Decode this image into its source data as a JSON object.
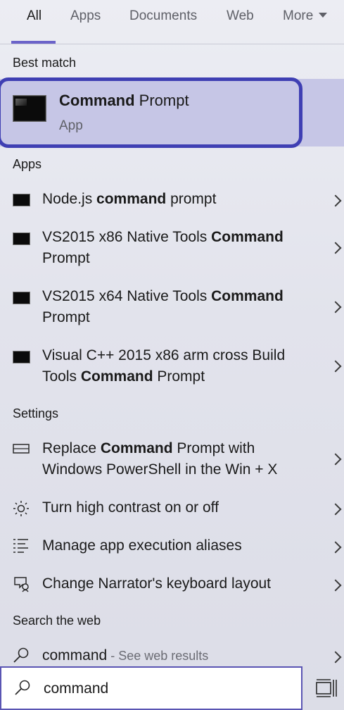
{
  "tabs": [
    {
      "label": "All"
    },
    {
      "label": "Apps"
    },
    {
      "label": "Documents"
    },
    {
      "label": "Web"
    },
    {
      "label": "More"
    }
  ],
  "sections": {
    "best_match": "Best match",
    "apps": "Apps",
    "settings": "Settings",
    "web": "Search the web"
  },
  "best": {
    "title_bold": "Command",
    "title_rest": " Prompt",
    "subtitle": "App"
  },
  "apps": [
    {
      "pre": "Node.js ",
      "bold": "command",
      "post": " prompt",
      "line2": ""
    },
    {
      "pre": "VS2015 x86 Native Tools ",
      "bold": "Command",
      "post": "",
      "line2": "Prompt"
    },
    {
      "pre": "VS2015 x64 Native Tools ",
      "bold": "Command",
      "post": "",
      "line2": "Prompt"
    },
    {
      "pre": "Visual C++ 2015 x86 arm cross Build",
      "bold": "",
      "post": "",
      "line2_pre": "Tools ",
      "line2_bold": "Command",
      "line2_post": " Prompt"
    }
  ],
  "settings": [
    {
      "pre": "Replace ",
      "bold": "Command",
      "post": " Prompt with",
      "line2": "Windows PowerShell in the Win + X",
      "icon": "window-icon"
    },
    {
      "text": "Turn high contrast on or off",
      "icon": "brightness-icon"
    },
    {
      "text": "Manage app execution aliases",
      "icon": "list-icon"
    },
    {
      "text": "Change Narrator's keyboard layout",
      "icon": "narrator-icon"
    }
  ],
  "web": {
    "query": "command",
    "hint": " - See web results"
  },
  "search": {
    "value": "command"
  },
  "colors": {
    "accent": "#6b63c9",
    "highlight": "#c6c6e6",
    "outline": "#3f3fb3"
  }
}
